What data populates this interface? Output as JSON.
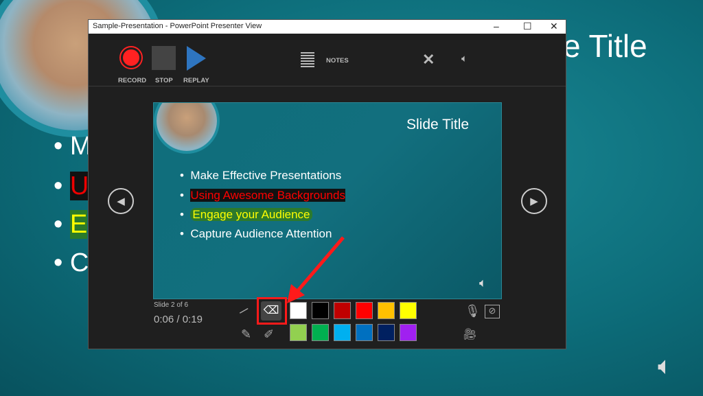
{
  "background": {
    "title_fragment": "e Title",
    "bullets": [
      "M",
      "U",
      "E",
      "C"
    ]
  },
  "window": {
    "title": "Sample-Presentation - PowerPoint Presenter View"
  },
  "toolbar": {
    "record": "RECORD",
    "stop": "STOP",
    "replay": "REPLAY",
    "notes": "NOTES"
  },
  "slide": {
    "title": "Slide Title",
    "bullets": [
      "Make Effective Presentations",
      "Using Awesome Backgrounds",
      "Engage your Audience",
      "Capture Audience Attention"
    ]
  },
  "status": {
    "slide_counter": "Slide 2 of 6",
    "elapsed": "0:06",
    "total": "0:19",
    "separator": "/"
  },
  "colors": {
    "row1": [
      "#ffffff",
      "#000000",
      "#c00000",
      "#ff0000",
      "#ffc000",
      "#ffff00"
    ],
    "row2": [
      "#92d050",
      "#00b050",
      "#00b0f0",
      "#0070c0",
      "#002060",
      "#a020f0"
    ],
    "highlight": "#ff1a1a"
  }
}
